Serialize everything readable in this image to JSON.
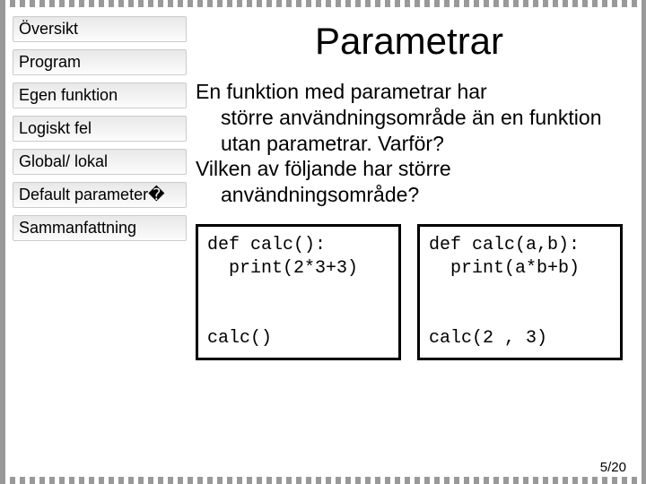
{
  "sidebar": {
    "items": [
      {
        "label": "Översikt"
      },
      {
        "label": "Program"
      },
      {
        "label": "Egen funktion"
      },
      {
        "label": "Logiskt fel"
      },
      {
        "label": "Global/ lokal"
      },
      {
        "label": "Default parameter�"
      },
      {
        "label": "Sammanfattning"
      }
    ]
  },
  "main": {
    "title": "Parametrar",
    "paragraph_line1": "En funktion med parametrar har",
    "paragraph_indent1": "större användningsområde än en funktion utan parametrar. Varför?",
    "paragraph_line2": "Vilken av följande har större",
    "paragraph_indent2": "användningsområde?",
    "code_left": "def calc():\n  print(2*3+3)\n\n\ncalc()",
    "code_right": "def calc(a,b):\n  print(a*b+b)\n\n\ncalc(2 , 3)"
  },
  "page": {
    "label": "5/20"
  }
}
